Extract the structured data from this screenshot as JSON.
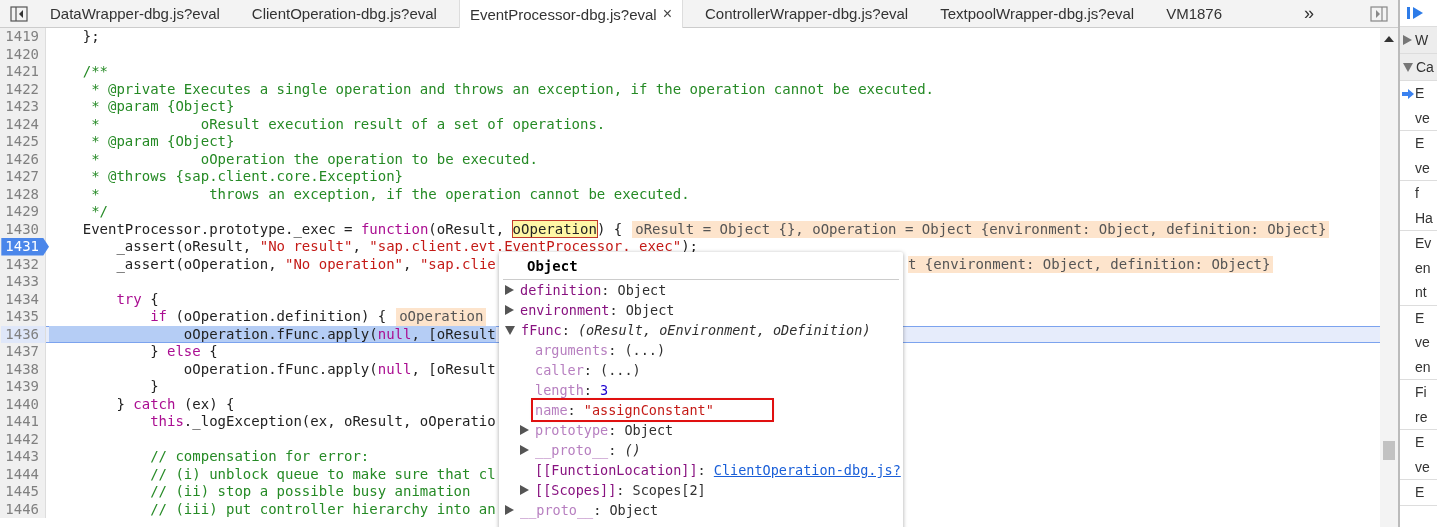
{
  "tabs": [
    {
      "label": "DataWrapper-dbg.js?eval",
      "selected": false
    },
    {
      "label": "ClientOperation-dbg.js?eval",
      "selected": false
    },
    {
      "label": "EventProcessor-dbg.js?eval",
      "selected": true,
      "close": "×"
    },
    {
      "label": "ControllerWrapper-dbg.js?eval",
      "selected": false
    },
    {
      "label": "TextpoolWrapper-dbg.js?eval",
      "selected": false
    },
    {
      "label": "VM1876",
      "selected": false
    }
  ],
  "tab_overflow": "»",
  "editor": {
    "lines": [
      {
        "num": "1419",
        "paused": false,
        "highlighted": false,
        "code": [
          {
            "kind": "plain",
            "t": "    };"
          }
        ]
      },
      {
        "num": "1420",
        "paused": false,
        "highlighted": false
      },
      {
        "num": "1421",
        "paused": false,
        "highlighted": false,
        "code": [
          {
            "kind": "com",
            "t": "    /**"
          }
        ]
      },
      {
        "num": "1422",
        "paused": false,
        "highlighted": false,
        "code": [
          {
            "kind": "com",
            "t": "     * @private Executes a single operation and throws an exception, if the operation cannot be executed."
          }
        ]
      },
      {
        "num": "1423",
        "paused": false,
        "highlighted": false,
        "code": [
          {
            "kind": "com",
            "t": "     * @param {Object}"
          }
        ]
      },
      {
        "num": "1424",
        "paused": false,
        "highlighted": false,
        "code": [
          {
            "kind": "com",
            "t": "     *            oResult execution result of a set of operations."
          }
        ]
      },
      {
        "num": "1425",
        "paused": false,
        "highlighted": false,
        "code": [
          {
            "kind": "com",
            "t": "     * @param {Object}"
          }
        ]
      },
      {
        "num": "1426",
        "paused": false,
        "highlighted": false,
        "code": [
          {
            "kind": "com",
            "t": "     *            oOperation the operation to be executed."
          }
        ]
      },
      {
        "num": "1427",
        "paused": false,
        "highlighted": false,
        "code": [
          {
            "kind": "com",
            "t": "     * @throws {sap.client.core.Exception}"
          }
        ]
      },
      {
        "num": "1428",
        "paused": false,
        "highlighted": false,
        "code": [
          {
            "kind": "com",
            "t": "     *             throws an exception, if the operation cannot be executed."
          }
        ]
      },
      {
        "num": "1429",
        "paused": false,
        "highlighted": false,
        "code": [
          {
            "kind": "com",
            "t": "     */"
          }
        ]
      },
      {
        "num": "1430",
        "paused": false,
        "highlighted": false,
        "code": [
          {
            "kind": "plain",
            "t": "    EventProcessor.prototype._exec = "
          },
          {
            "kind": "kw",
            "t": "function"
          },
          {
            "kind": "plain",
            "t": "(oResult, "
          },
          {
            "kind": "hover",
            "t": "oOperation"
          },
          {
            "kind": "plain",
            "t": ") {"
          }
        ],
        "inline": "oResult = Object {}, oOperation = Object {environment: Object, definition: Object}"
      },
      {
        "num": "1431",
        "paused": true,
        "highlighted": false,
        "code": [
          {
            "kind": "plain",
            "t": "        _assert(oResult, "
          },
          {
            "kind": "str",
            "t": "\"No result\""
          },
          {
            "kind": "plain",
            "t": ", "
          },
          {
            "kind": "str",
            "t": "\"sap.client.evt.EventProcessor._exec\""
          },
          {
            "kind": "plain",
            "t": ");"
          }
        ]
      },
      {
        "num": "1432",
        "paused": false,
        "highlighted": false,
        "code": [
          {
            "kind": "plain",
            "t": "        _assert(oOperation, "
          },
          {
            "kind": "str",
            "t": "\"No operation\""
          },
          {
            "kind": "plain",
            "t": ", "
          },
          {
            "kind": "str",
            "t": "\"sap.clie"
          }
        ],
        "inline_after": "t {environment: Object, definition: Object}"
      },
      {
        "num": "1433",
        "paused": false,
        "highlighted": false
      },
      {
        "num": "1434",
        "paused": false,
        "highlighted": false,
        "code": [
          {
            "kind": "kw",
            "t": "        try"
          },
          {
            "kind": "plain",
            "t": " {"
          }
        ]
      },
      {
        "num": "1435",
        "paused": false,
        "highlighted": false,
        "code": [
          {
            "kind": "kw",
            "t": "            if"
          },
          {
            "kind": "plain",
            "t": " (oOperation.definition) {"
          }
        ],
        "inline": "oOperation"
      },
      {
        "num": "1436",
        "paused": false,
        "highlighted": true,
        "code": [
          {
            "kind": "sel",
            "t": "                oOperation.fFunc.apply("
          },
          {
            "kind": "selkw",
            "t": "null"
          },
          {
            "kind": "sel",
            "t": ", [oResult"
          }
        ]
      },
      {
        "num": "1437",
        "paused": false,
        "highlighted": false,
        "code": [
          {
            "kind": "plain",
            "t": "            } "
          },
          {
            "kind": "kw",
            "t": "else"
          },
          {
            "kind": "plain",
            "t": " {"
          }
        ]
      },
      {
        "num": "1438",
        "paused": false,
        "highlighted": false,
        "code": [
          {
            "kind": "plain",
            "t": "                oOperation.fFunc.apply("
          },
          {
            "kind": "kw",
            "t": "null"
          },
          {
            "kind": "plain",
            "t": ", [oResult"
          }
        ]
      },
      {
        "num": "1439",
        "paused": false,
        "highlighted": false,
        "code": [
          {
            "kind": "plain",
            "t": "            }"
          }
        ]
      },
      {
        "num": "1440",
        "paused": false,
        "highlighted": false,
        "code": [
          {
            "kind": "plain",
            "t": "        } "
          },
          {
            "kind": "kw",
            "t": "catch"
          },
          {
            "kind": "plain",
            "t": " (ex) {"
          }
        ]
      },
      {
        "num": "1441",
        "paused": false,
        "highlighted": false,
        "code": [
          {
            "kind": "kw",
            "t": "            this"
          },
          {
            "kind": "plain",
            "t": "._logException(ex, oResult, oOperatio"
          }
        ]
      },
      {
        "num": "1442",
        "paused": false,
        "highlighted": false
      },
      {
        "num": "1443",
        "paused": false,
        "highlighted": false,
        "code": [
          {
            "kind": "com",
            "t": "            // compensation for error:"
          }
        ]
      },
      {
        "num": "1444",
        "paused": false,
        "highlighted": false,
        "code": [
          {
            "kind": "com",
            "t": "            // (i) unblock queue to make sure that cl"
          }
        ]
      },
      {
        "num": "1445",
        "paused": false,
        "highlighted": false,
        "code": [
          {
            "kind": "com",
            "t": "            // (ii) stop a possible busy animation"
          }
        ]
      },
      {
        "num": "1446",
        "paused": false,
        "highlighted": false,
        "code": [
          {
            "kind": "com",
            "t": "            // (iii) put controller hierarchy into an"
          }
        ]
      }
    ]
  },
  "popup": {
    "title": "Object",
    "tree": [
      {
        "key": "definition",
        "sep": ":",
        "value": "Object",
        "kind": "plain",
        "faded": false,
        "expanded": false,
        "boxed": false
      },
      {
        "key": "environment",
        "sep": ":",
        "value": "Object",
        "kind": "plain",
        "faded": false,
        "expanded": false,
        "boxed": false
      },
      {
        "key": "fFunc",
        "sep": ":",
        "value": "(oResult, oEnvironment, oDefinition)",
        "kind": "italic",
        "faded": false,
        "expanded": true,
        "boxed": false,
        "children": [
          {
            "key": "arguments",
            "sep": ":",
            "value": "(...)",
            "kind": "plain",
            "faded": true,
            "boxed": false
          },
          {
            "key": "caller",
            "sep": ":",
            "value": "(...)",
            "kind": "plain",
            "faded": true,
            "boxed": false
          },
          {
            "key": "length",
            "sep": ":",
            "value": "3",
            "kind": "number",
            "faded": true,
            "boxed": false
          },
          {
            "key": "name",
            "sep": ":",
            "value": "\"assignConstant\"",
            "kind": "string",
            "faded": true,
            "boxed": true
          },
          {
            "key": "prototype",
            "sep": ":",
            "value": "Object",
            "kind": "plain",
            "faded": true,
            "expanded": false,
            "boxed": false
          },
          {
            "key": "__proto__",
            "sep": ":",
            "value": "()",
            "kind": "italic",
            "faded": true,
            "expanded": false,
            "boxed": false
          },
          {
            "key": "[[FunctionLocation]]",
            "sep": ":",
            "value": "ClientOperation-dbg.js?",
            "kind": "link",
            "faded": false,
            "boxed": false
          },
          {
            "key": "[[Scopes]]",
            "sep": ":",
            "value": "Scopes[2]",
            "kind": "plain",
            "faded": false,
            "expanded": false,
            "boxed": false
          }
        ]
      },
      {
        "key": "__proto__",
        "sep": ":",
        "value": "Object",
        "kind": "plain",
        "faded": true,
        "expanded": false,
        "boxed": false
      }
    ]
  },
  "sidebar": {
    "sections": [
      {
        "label": "W",
        "expanded": false
      },
      {
        "label": "Ca",
        "expanded": true
      }
    ],
    "call_frames": [
      {
        "current": true,
        "lines": [
          "E",
          "ve"
        ]
      },
      {
        "current": false,
        "lines": [
          "E",
          "ve"
        ]
      },
      {
        "current": false,
        "lines": [
          "f",
          "Ha"
        ]
      },
      {
        "current": false,
        "lines": [
          "Ev",
          "en",
          "nt"
        ]
      },
      {
        "current": false,
        "lines": [
          "E",
          "ve",
          "en"
        ]
      },
      {
        "current": false,
        "lines": [
          "Fi",
          "re"
        ]
      },
      {
        "current": false,
        "lines": [
          "E",
          "ve"
        ]
      },
      {
        "current": false,
        "lines": [
          "E"
        ]
      }
    ]
  }
}
